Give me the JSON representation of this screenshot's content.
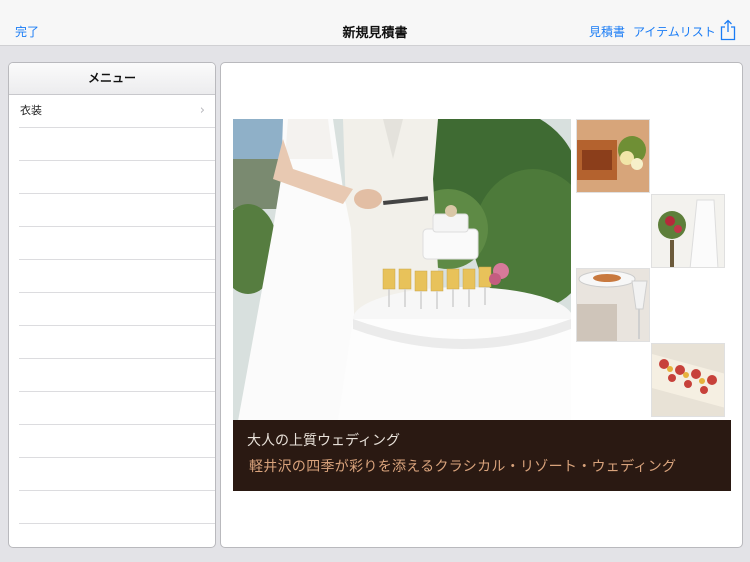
{
  "navbar": {
    "done_label": "完了",
    "title": "新規見積書",
    "estimate_label": "見積書",
    "item_list_label": "アイテムリスト",
    "share_icon": "share-icon"
  },
  "menu": {
    "header": "メニュー",
    "items": [
      {
        "label": "衣装",
        "icon": "chevron-right-icon"
      }
    ]
  },
  "content": {
    "caption_title": "大人の上質ウェディング",
    "caption_subtitle": "軽井沢の四季が彩りを添えるクラシカル・リゾート・ウェディング"
  },
  "colors": {
    "accent": "#1a7cf5",
    "caption_band": "#2a1912",
    "caption_subtitle": "#d9a37c"
  }
}
